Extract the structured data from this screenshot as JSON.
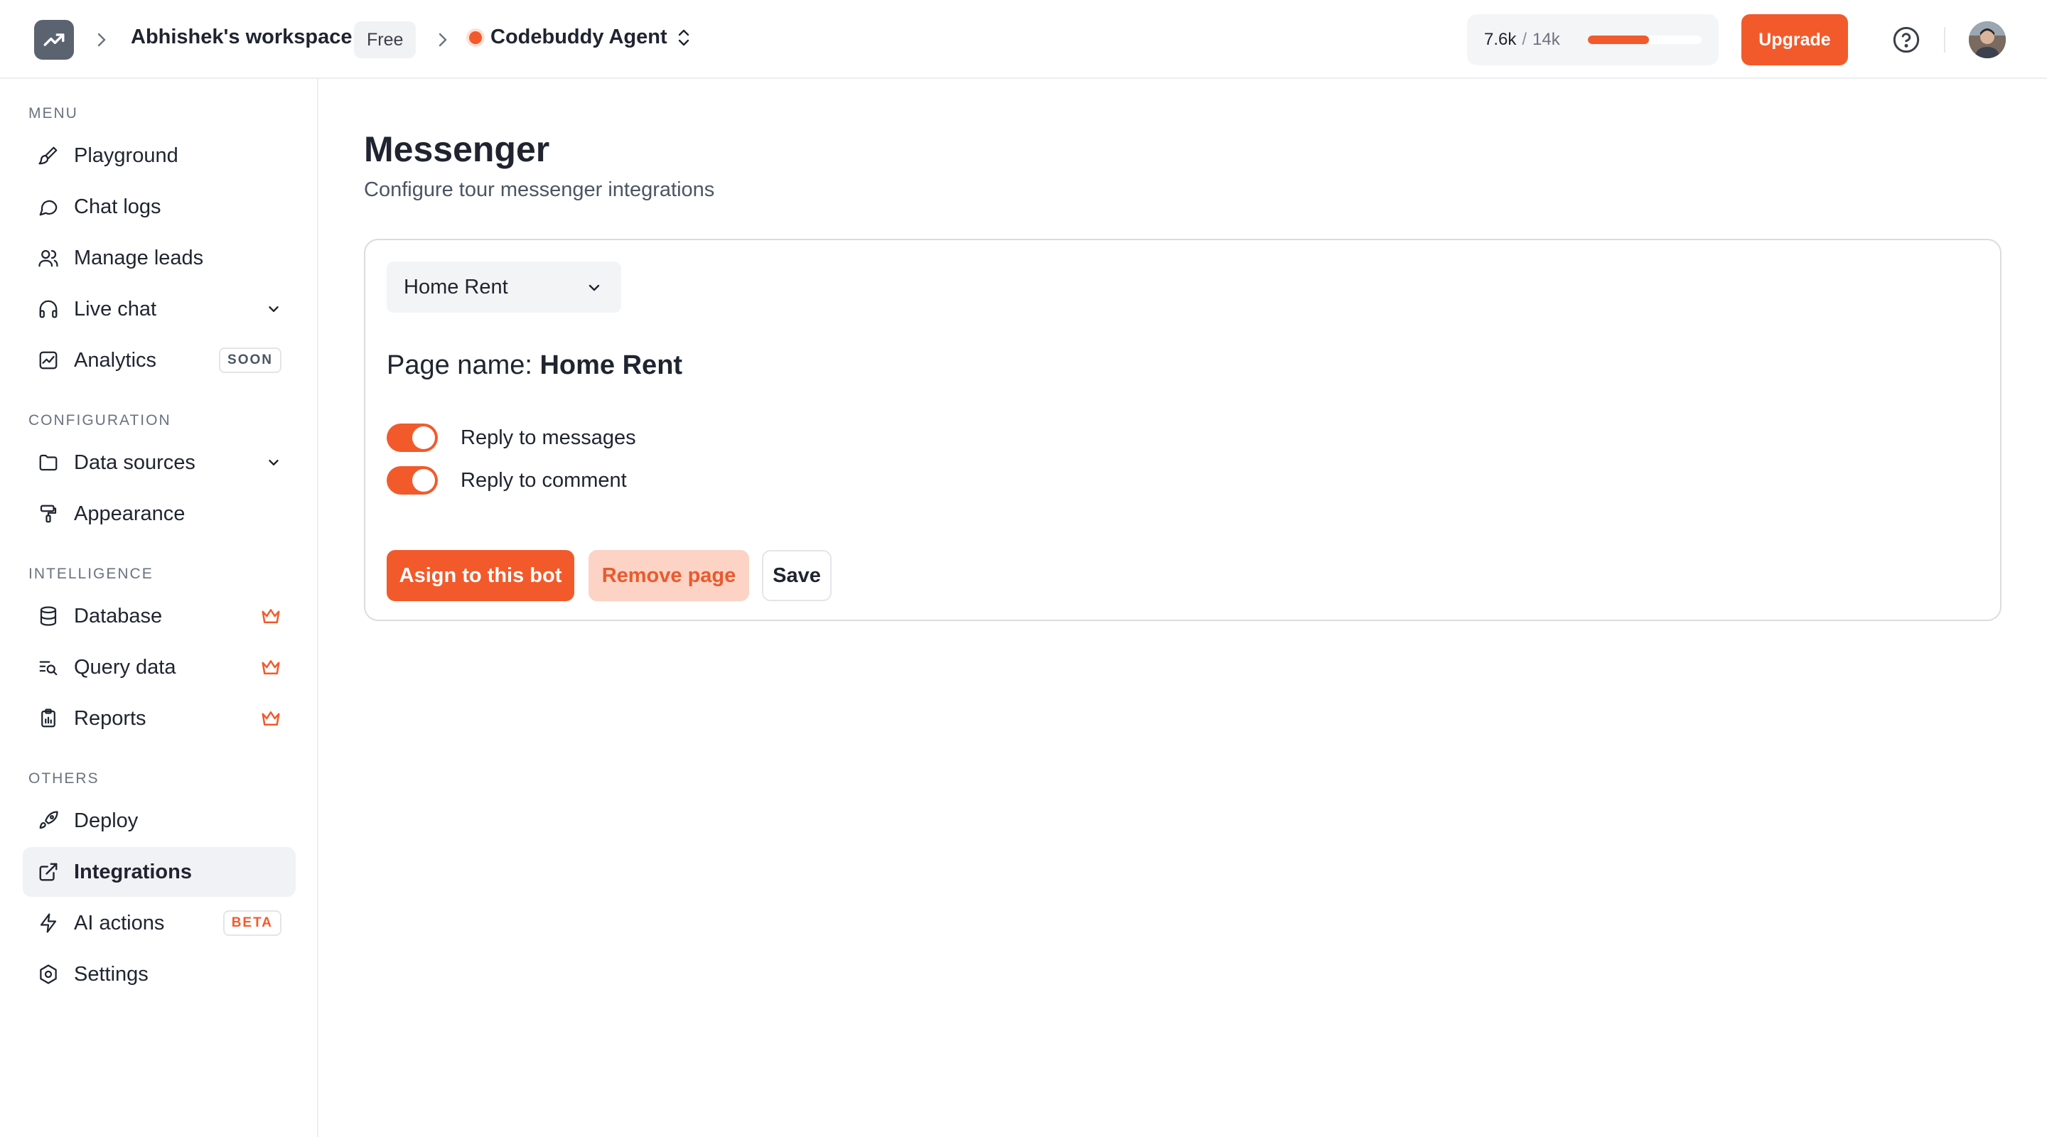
{
  "topbar": {
    "workspace_name": "Abhishek's workspace",
    "plan": "Free",
    "agent_name": "Codebuddy Agent",
    "usage_used": "7.6k",
    "usage_sep": "/",
    "usage_total": "14k",
    "usage_fraction": 0.54,
    "upgrade_label": "Upgrade",
    "accent_color": "#f25a2b"
  },
  "sidebar": {
    "sections": {
      "menu": "MENU",
      "configuration": "CONFIGURATION",
      "intelligence": "INTELLIGENCE",
      "others": "OTHERS"
    },
    "items": {
      "playground": "Playground",
      "chat_logs": "Chat logs",
      "manage_leads": "Manage leads",
      "live_chat": "Live chat",
      "analytics": "Analytics",
      "analytics_tag": "SOON",
      "data_sources": "Data sources",
      "appearance": "Appearance",
      "database": "Database",
      "query_data": "Query data",
      "reports": "Reports",
      "deploy": "Deploy",
      "integrations": "Integrations",
      "ai_actions": "AI actions",
      "ai_actions_tag": "BETA",
      "settings": "Settings"
    },
    "active_item": "Integrations"
  },
  "main": {
    "title": "Messenger",
    "subtitle": "Configure tour messenger integrations",
    "page_select_value": "Home Rent",
    "page_name_label": "Page name:",
    "page_name_value": "Home Rent",
    "toggles": {
      "reply_messages": "Reply to messages",
      "reply_comment": "Reply to comment"
    },
    "buttons": {
      "assign": "Asign to this bot",
      "remove": "Remove page",
      "save": "Save"
    }
  }
}
